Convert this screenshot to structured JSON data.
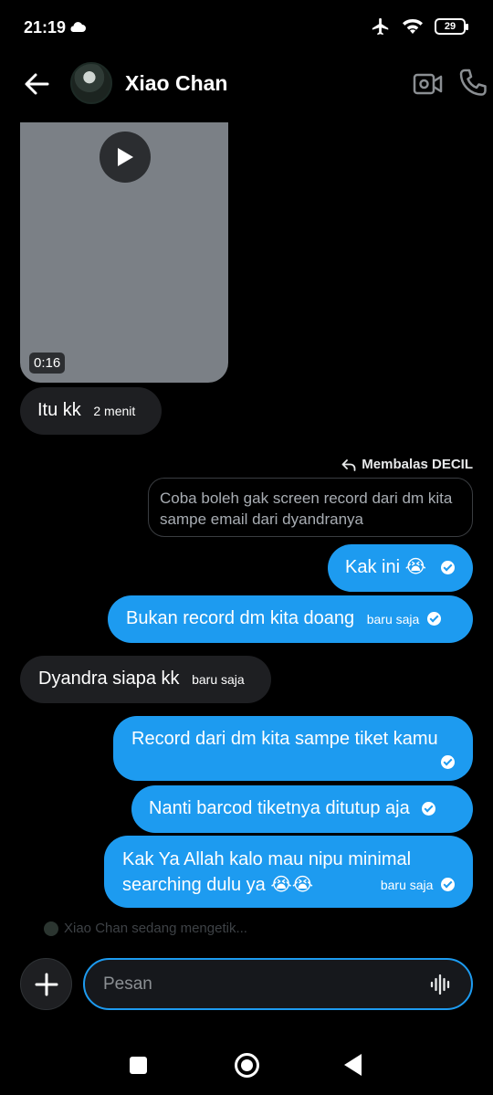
{
  "status_bar": {
    "time": "21:19",
    "battery": "29"
  },
  "header": {
    "name": "Xiao Chan"
  },
  "video": {
    "duration": "0:16"
  },
  "messages": {
    "m1": {
      "text": "Itu kk",
      "time": "2 menit"
    },
    "reply_label": "Membalas DECIL",
    "quoted": "Coba boleh gak screen record dari dm kita sampe email dari dyandranya",
    "m2": {
      "text": "Kak ini 😭"
    },
    "m3": {
      "text": "Bukan record dm kita doang",
      "time": "baru saja"
    },
    "m4": {
      "text": "Dyandra siapa kk",
      "time": "baru saja"
    },
    "m5": {
      "text": "Record dari dm kita sampe tiket kamu"
    },
    "m6": {
      "text": "Nanti barcod tiketnya ditutup aja"
    },
    "m7": {
      "line1": "Kak Ya Allah kalo mau nipu minimal",
      "line2": "searching dulu ya 😭😭",
      "time": "baru saja"
    }
  },
  "typing": "Xiao Chan sedang mengetik...",
  "composer": {
    "placeholder": "Pesan"
  },
  "colors": {
    "accent": "#1d9bf0",
    "incoming": "#1e1f22",
    "background": "#000000"
  }
}
